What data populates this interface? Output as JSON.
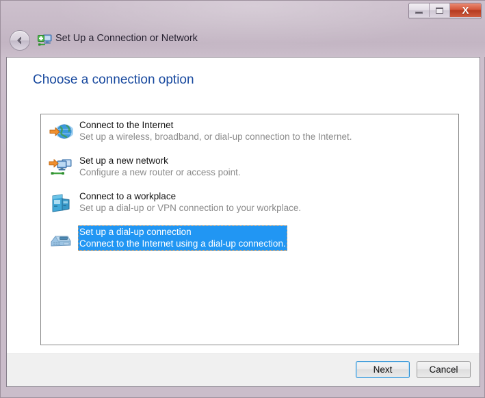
{
  "window": {
    "title": "Set Up a Connection or Network",
    "title_icon": "network-connection-add-icon",
    "back_button": "back-arrow-icon",
    "controls": {
      "minimize": "minimize-icon",
      "maximize": "maximize-icon",
      "close": "X"
    },
    "colors": {
      "title_bar": "#c8bbc8",
      "heading_blue": "#17489e",
      "selection_blue": "#2196f3",
      "close_red": "#c1452a",
      "footer_gray": "#f0f0f0"
    }
  },
  "page": {
    "heading": "Choose a connection option"
  },
  "options": [
    {
      "title": "Connect to the Internet",
      "description": "Set up a wireless, broadband, or dial-up connection to the Internet.",
      "icon": "globe-arrow-icon",
      "selected": false
    },
    {
      "title": "Set up a new network",
      "description": "Configure a new router or access point.",
      "icon": "monitors-arrow-icon",
      "selected": false
    },
    {
      "title": "Connect to a workplace",
      "description": "Set up a dial-up or VPN connection to your workplace.",
      "icon": "server-tower-icon",
      "selected": false
    },
    {
      "title": "Set up a dial-up connection",
      "description": "Connect to the Internet using a dial-up connection.",
      "icon": "modem-fax-icon",
      "selected": true
    }
  ],
  "footer": {
    "next_label": "Next",
    "cancel_label": "Cancel"
  }
}
